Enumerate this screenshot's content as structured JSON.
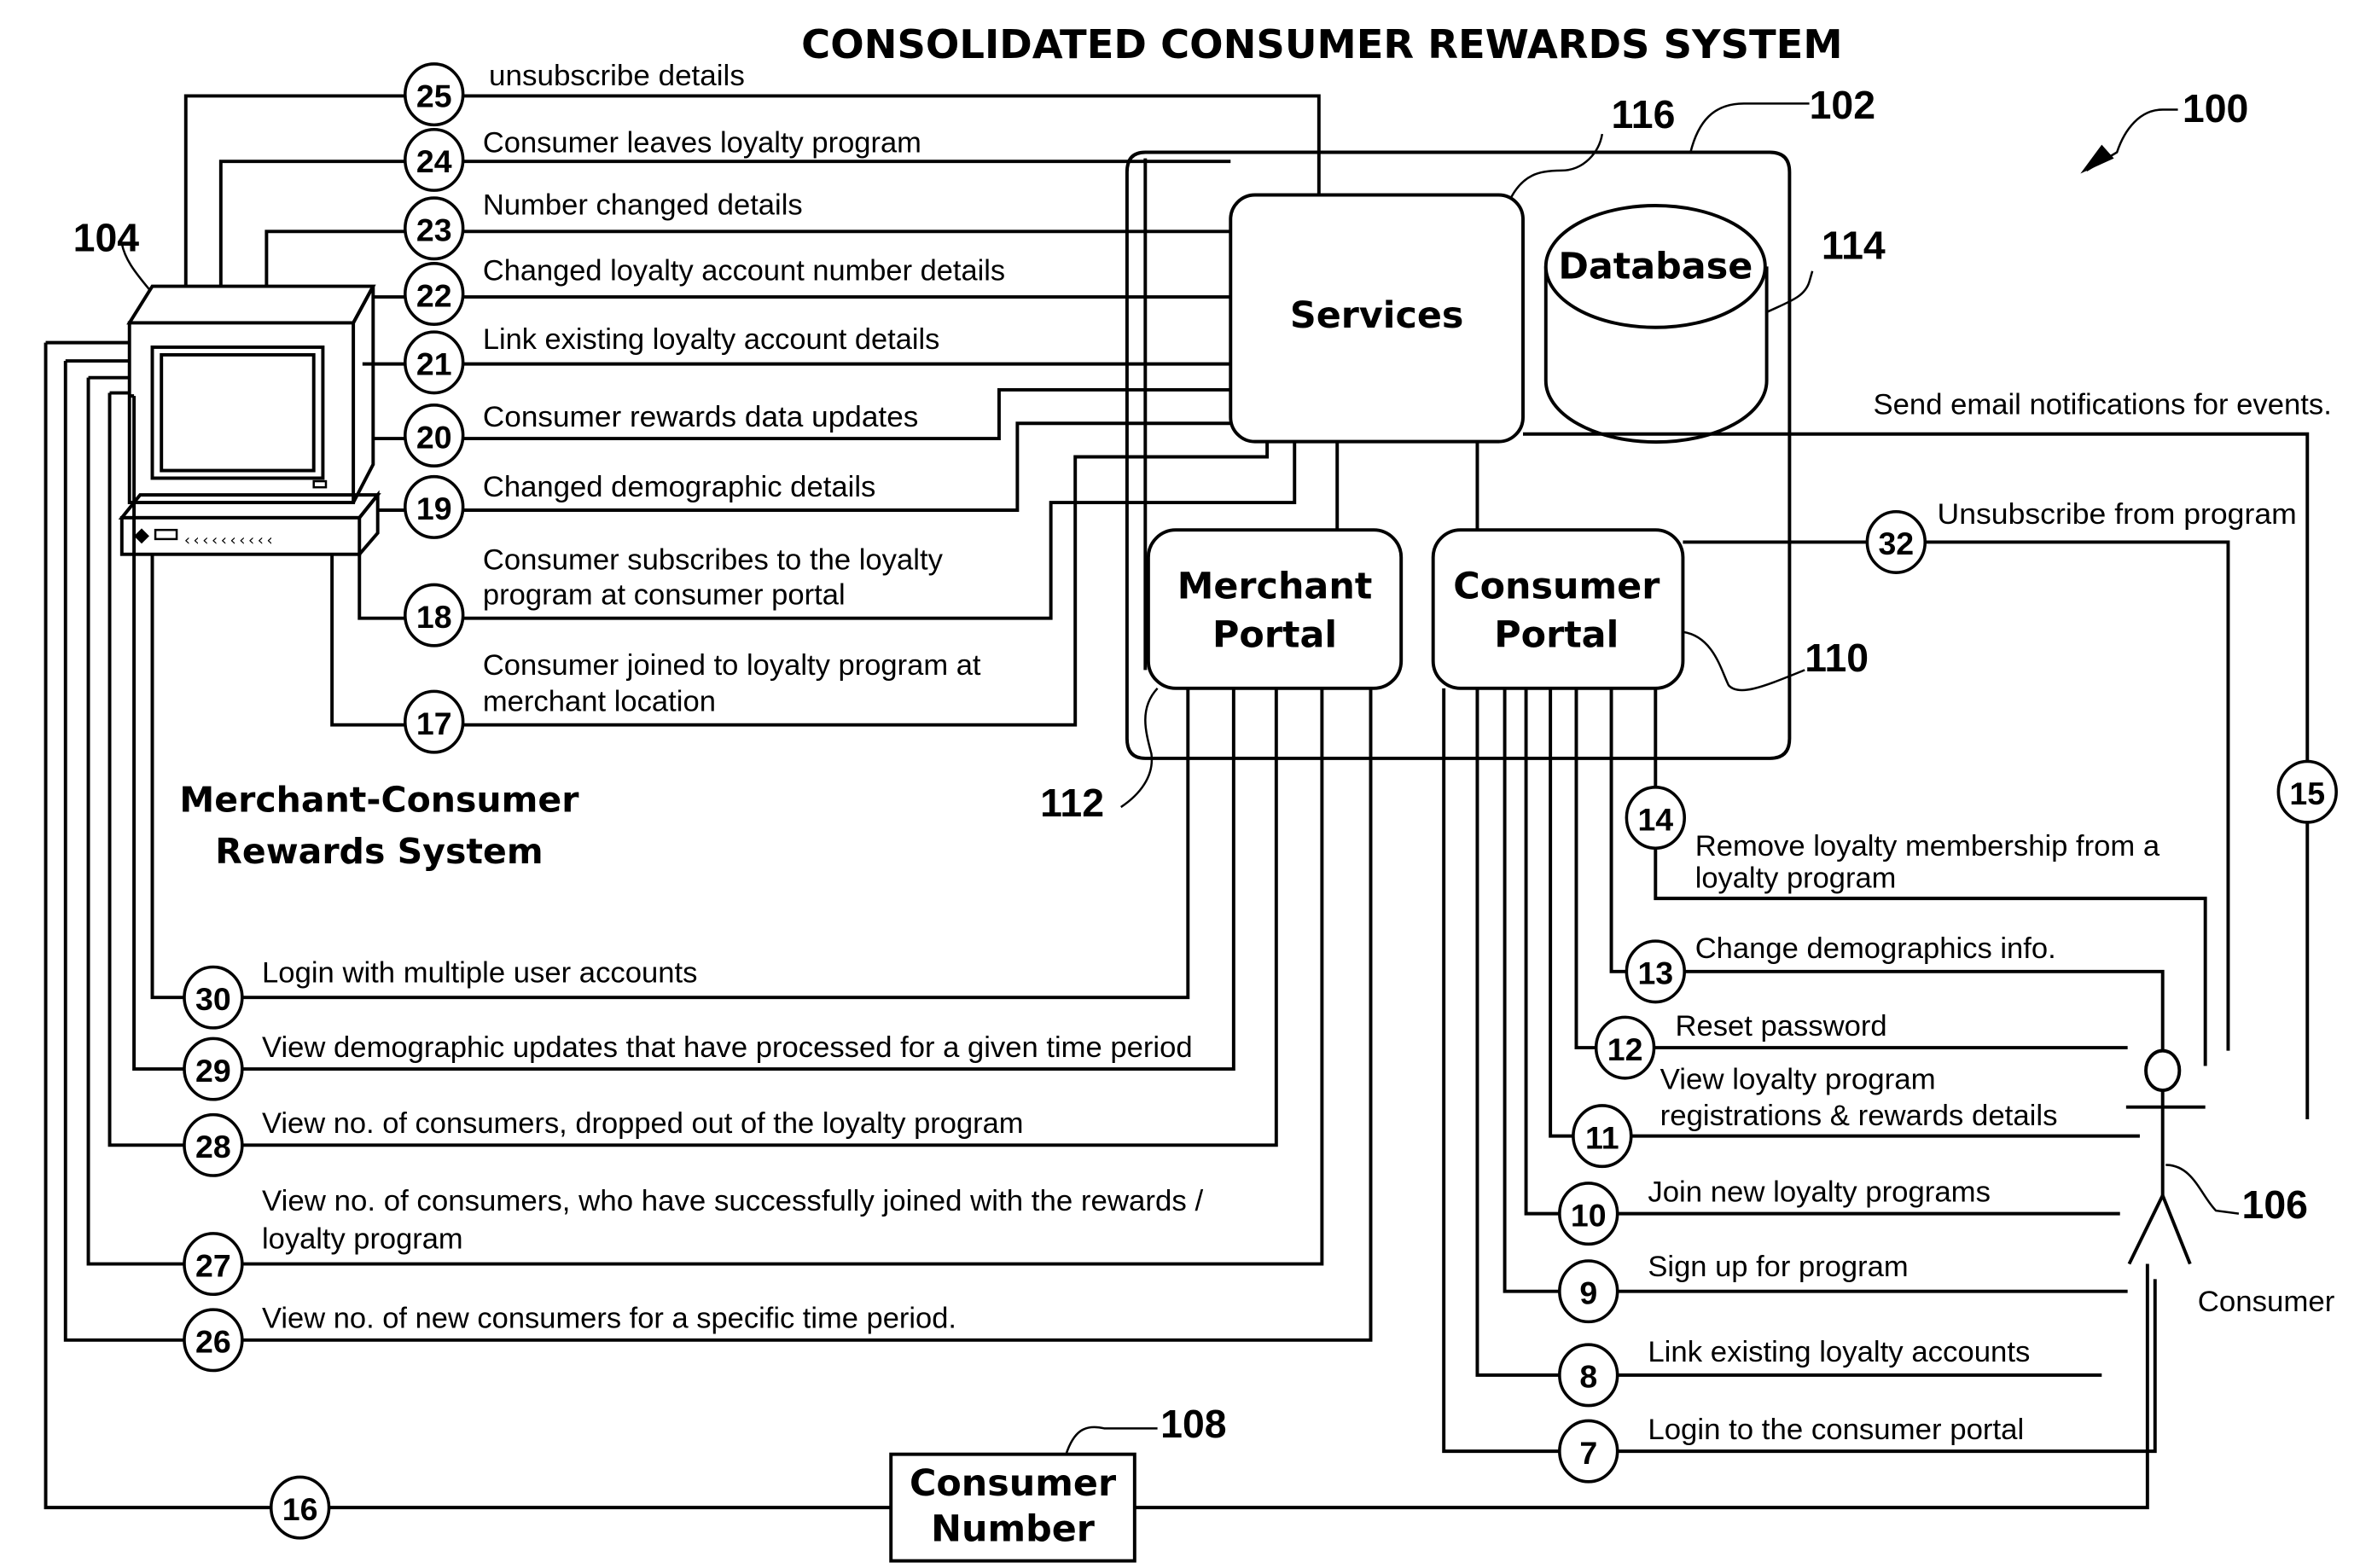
{
  "title": "CONSOLIDATED CONSUMER REWARDS SYSTEM",
  "references": {
    "system": "100",
    "platform": "102",
    "merchant_terminal": "104",
    "consumer": "106",
    "consumer_number": "108",
    "consumer_portal": "110",
    "merchant_portal": "112",
    "database": "114",
    "services": "116"
  },
  "components": {
    "services": "Services",
    "database": "Database",
    "merchant_portal": [
      "Merchant",
      "Portal"
    ],
    "consumer_portal": [
      "Consumer",
      "Portal"
    ],
    "consumer_number": [
      "Consumer",
      "Number"
    ],
    "merchant_system": [
      "Merchant-Consumer",
      "Rewards System"
    ],
    "consumer_actor": "Consumer"
  },
  "merchant_flows": [
    {
      "step": "25",
      "label": [
        "unsubscribe details"
      ]
    },
    {
      "step": "24",
      "label": [
        "Consumer leaves loyalty program"
      ]
    },
    {
      "step": "23",
      "label": [
        "Number changed details"
      ]
    },
    {
      "step": "22",
      "label": [
        "Changed loyalty account number details"
      ]
    },
    {
      "step": "21",
      "label": [
        "Link existing loyalty account details"
      ]
    },
    {
      "step": "20",
      "label": [
        "Consumer  rewards data updates"
      ]
    },
    {
      "step": "19",
      "label": [
        "Changed demographic details"
      ]
    },
    {
      "step": "18",
      "label": [
        "Consumer subscribes to the loyalty",
        "program at consumer portal"
      ]
    },
    {
      "step": "17",
      "label": [
        "Consumer joined to loyalty program at",
        "merchant location"
      ]
    }
  ],
  "merchant_portal_flows": [
    {
      "step": "30",
      "label": [
        "Login with multiple user accounts"
      ]
    },
    {
      "step": "29",
      "label": [
        "View demographic updates that have processed for a given time period"
      ]
    },
    {
      "step": "28",
      "label": [
        "View no. of consumers, dropped out of the loyalty program"
      ]
    },
    {
      "step": "27",
      "label": [
        "View no. of consumers, who have successfully joined  with the rewards /",
        "loyalty program"
      ]
    },
    {
      "step": "26",
      "label": [
        "View no. of new consumers for a specific time period."
      ]
    }
  ],
  "consumer_flows": [
    {
      "step": "14",
      "label": [
        "Remove loyalty membership from a",
        "loyalty program"
      ]
    },
    {
      "step": "13",
      "label": [
        "Change demographics info."
      ]
    },
    {
      "step": "12",
      "label": [
        "Reset password"
      ]
    },
    {
      "step": "11",
      "label": [
        "View loyalty program",
        "registrations & rewards details"
      ]
    },
    {
      "step": "10",
      "label": [
        "Join new loyalty programs"
      ]
    },
    {
      "step": "9",
      "label": [
        "Sign up for program"
      ]
    },
    {
      "step": "8",
      "label": [
        "Link existing loyalty accounts"
      ]
    },
    {
      "step": "7",
      "label": [
        "Login to the consumer portal"
      ]
    }
  ],
  "other_flows": {
    "unsubscribe": {
      "step": "32",
      "label": "Unsubscribe from  program"
    },
    "email": {
      "step": "15",
      "label": "Send email notifications for events."
    },
    "consumer_number": {
      "step": "16"
    }
  }
}
